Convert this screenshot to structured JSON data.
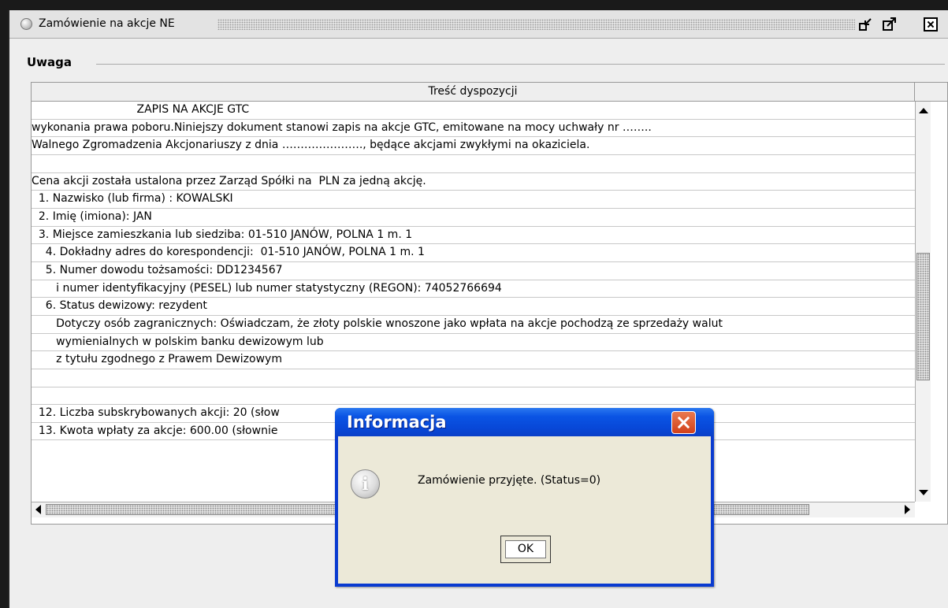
{
  "window": {
    "title": "Zamówienie na akcje NE",
    "icons": [
      "window-dot-icon",
      "minimize-icon",
      "maximize-icon",
      "close-icon"
    ]
  },
  "group": {
    "legend": "Uwaga"
  },
  "table": {
    "column_header": "Treść dyspozycji",
    "rows": [
      "                              ZAPIS NA AKCJE GTC",
      "wykonania prawa poboru.Niniejszy dokument stanowi zapis na akcje GTC, emitowane na mocy uchwały nr ……..",
      "Walnego Zgromadzenia Akcjonariuszy z dnia …………………., będące akcjami zwykłymi na okaziciela.",
      "",
      "Cena akcji została ustalona przez Zarząd Spółki na  PLN za jedną akcję.",
      "  1. Nazwisko (lub firma) : KOWALSKI",
      "  2. Imię (imiona): JAN",
      "  3. Miejsce zamieszkania lub siedziba: 01-510 JANÓW, POLNA 1 m. 1",
      "    4. Dokładny adres do korespondencji:  01-510 JANÓW, POLNA 1 m. 1",
      "    5. Numer dowodu tożsamości: DD1234567",
      "       i numer identyfikacyjny (PESEL) lub numer statystyczny (REGON): 74052766694",
      "    6. Status dewizowy: rezydent",
      "       Dotyczy osób zagranicznych: Oświadczam, że złoty polskie wnoszone jako wpłata na akcje pochodzą ze sprzedaży walut",
      "       wymienialnych w polskim banku dewizowym lub",
      "       z tytułu zgodnego z Prawem Dewizowym",
      "",
      "",
      "  12. Liczba subskrybowanych akcji: 20 (słow",
      "  13. Kwota wpłaty za akcje: 600.00 (słownie"
    ]
  },
  "dialog": {
    "title": "Informacja",
    "message": "Zamówienie przyjęte. (Status=0)",
    "ok_label": "OK",
    "icon": "info-icon",
    "close_icon": "close-icon"
  },
  "colors": {
    "dialog_title_blue": "#0a54e4",
    "dialog_close_red": "#d2411a",
    "dialog_body": "#ece9d8",
    "frame_bg": "#eeeeee"
  }
}
